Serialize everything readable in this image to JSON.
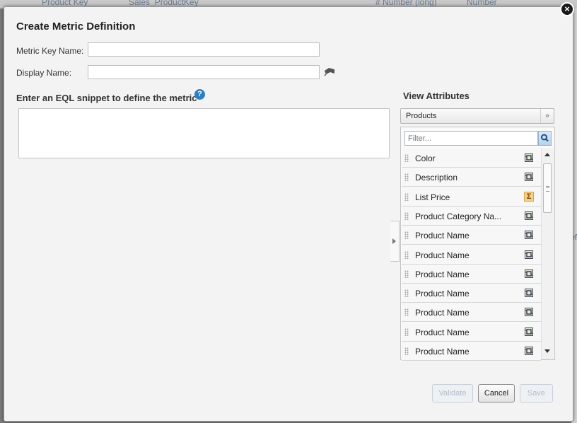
{
  "background": {
    "row_cells": [
      "Product Key",
      "Sales_ProductKey",
      "# Number (long)",
      "Number"
    ],
    "right_fragment": "ef"
  },
  "dialog": {
    "title": "Create Metric Definition",
    "metric_key_label": "Metric Key Name:",
    "metric_key_value": "",
    "display_name_label": "Display Name:",
    "display_name_value": "",
    "eql_label": "Enter an EQL snippet to define the metric",
    "eql_value": "",
    "close_label": "×"
  },
  "view_attributes": {
    "title": "View Attributes",
    "selected_view": "Products",
    "filter_placeholder": "Filter...",
    "items": [
      {
        "label": "Color",
        "icon": "text-attribute-icon"
      },
      {
        "label": "Description",
        "icon": "text-attribute-icon"
      },
      {
        "label": "List Price",
        "icon": "sum-metric-icon"
      },
      {
        "label": "Product Category Na...",
        "icon": "text-attribute-icon"
      },
      {
        "label": "Product Name",
        "icon": "text-attribute-icon"
      },
      {
        "label": "Product Name",
        "icon": "text-attribute-icon"
      },
      {
        "label": "Product Name",
        "icon": "text-attribute-icon"
      },
      {
        "label": "Product Name",
        "icon": "text-attribute-icon"
      },
      {
        "label": "Product Name",
        "icon": "text-attribute-icon"
      },
      {
        "label": "Product Name",
        "icon": "text-attribute-icon"
      },
      {
        "label": "Product Name",
        "icon": "text-attribute-icon"
      }
    ]
  },
  "buttons": {
    "validate": "Validate",
    "cancel": "Cancel",
    "save": "Save"
  }
}
